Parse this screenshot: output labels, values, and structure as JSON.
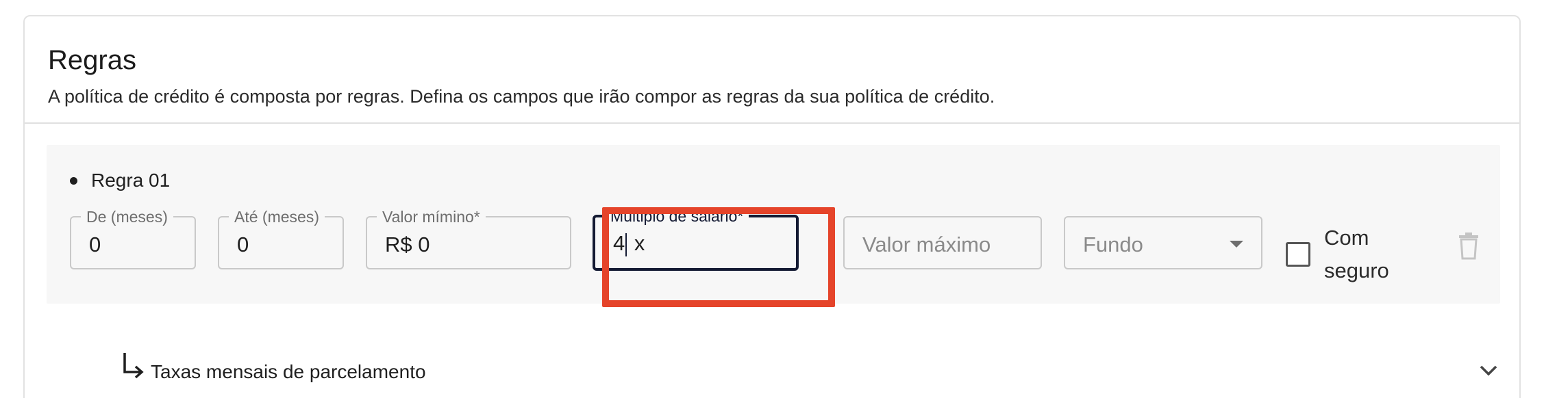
{
  "section": {
    "title": "Regras",
    "subtitle": "A política de crédito é composta por regras. Defina os campos que irão compor as regras da sua política de crédito."
  },
  "rule": {
    "label": "Regra 01",
    "fields": {
      "from_months": {
        "label": "De (meses)",
        "value": "0"
      },
      "to_months": {
        "label": "Até (meses)",
        "value": "0"
      },
      "min_value": {
        "label": "Valor mímino*",
        "value": "R$ 0"
      },
      "salary_multiple": {
        "label": "Múltiplo de salário*",
        "value_before_caret": "4",
        "value_after_caret": " x"
      },
      "max_value": {
        "placeholder": "Valor máximo"
      },
      "fund": {
        "placeholder": "Fundo"
      }
    },
    "insurance_checkbox": {
      "label": "Com seguro",
      "checked": false
    },
    "delete_icon": "trash-icon"
  },
  "expand": {
    "label": "Taxas mensais de parcelamento",
    "arrow_icon": "arrow-down-right-icon",
    "chevron_icon": "chevron-down-icon"
  },
  "colors": {
    "highlight": "#e5442a",
    "active_border": "#141a33"
  }
}
